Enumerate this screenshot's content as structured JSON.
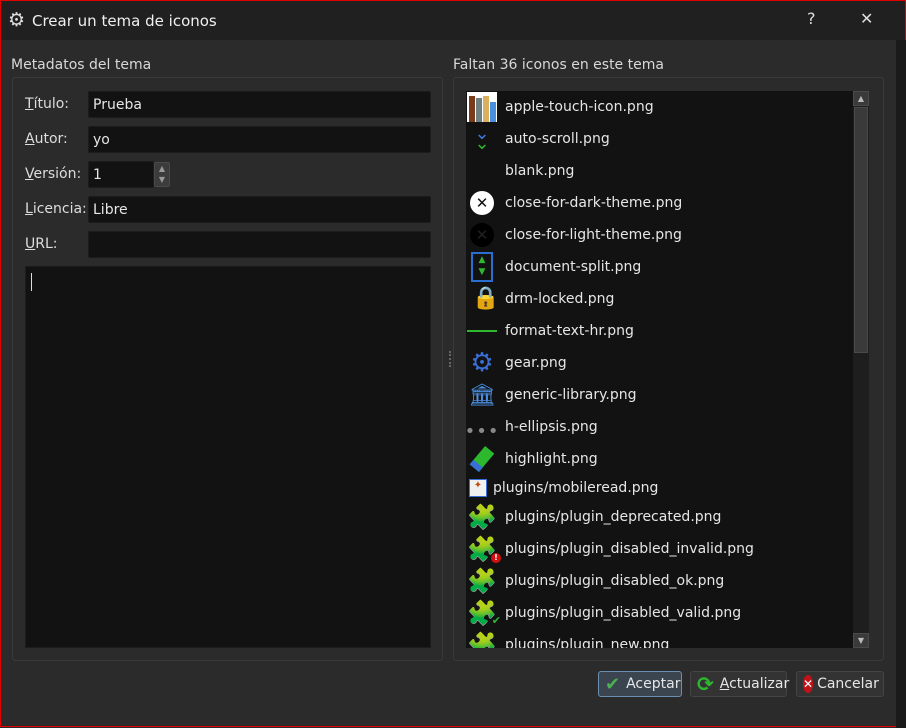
{
  "window": {
    "title": "Crear un tema de iconos",
    "help": "?",
    "close": "✕"
  },
  "left": {
    "group_title": "Metadatos del tema",
    "fields": [
      {
        "label_key": "T",
        "label_rest": "ítulo:",
        "value": "Prueba"
      },
      {
        "label_key": "A",
        "label_rest": "utor:",
        "value": "yo"
      },
      {
        "label_key": "V",
        "label_rest": "ersión:",
        "value": "1"
      },
      {
        "label_key": "L",
        "label_rest": "icencia:",
        "value": "Libre"
      },
      {
        "label_key": "U",
        "label_rest": "RL:",
        "value": ""
      }
    ],
    "description": ""
  },
  "right": {
    "group_title": "Faltan 36 iconos en este tema",
    "items": [
      {
        "icon": "books-icon",
        "name": "apple-touch-icon.png"
      },
      {
        "icon": "chevron-double-down-icon",
        "name": "auto-scroll.png"
      },
      {
        "icon": "blank-icon",
        "name": "blank.png"
      },
      {
        "icon": "close-white-icon",
        "name": "close-for-dark-theme.png"
      },
      {
        "icon": "close-black-icon",
        "name": "close-for-light-theme.png"
      },
      {
        "icon": "document-split-icon",
        "name": "document-split.png"
      },
      {
        "icon": "lock-icon",
        "name": "drm-locked.png"
      },
      {
        "icon": "hr-line-icon",
        "name": "format-text-hr.png"
      },
      {
        "icon": "gear-icon",
        "name": "gear.png"
      },
      {
        "icon": "library-icon",
        "name": "generic-library.png"
      },
      {
        "icon": "ellipsis-icon",
        "name": "h-ellipsis.png"
      },
      {
        "icon": "highlighter-icon",
        "name": "highlight.png"
      },
      {
        "icon": "mobileread-icon",
        "name": "plugins/mobileread.png"
      },
      {
        "icon": "puzzle-blue-icon",
        "name": "plugins/plugin_deprecated.png"
      },
      {
        "icon": "puzzle-invalid-icon",
        "name": "plugins/plugin_disabled_invalid.png"
      },
      {
        "icon": "puzzle-gray-icon",
        "name": "plugins/plugin_disabled_ok.png"
      },
      {
        "icon": "puzzle-valid-icon",
        "name": "plugins/plugin_disabled_valid.png"
      },
      {
        "icon": "puzzle-yellow-icon",
        "name": "plugins/plugin_new.png"
      }
    ]
  },
  "buttons": {
    "ok": "Aceptar",
    "update_key": "A",
    "update_rest": "ctualizar",
    "cancel": "Cancelar"
  }
}
